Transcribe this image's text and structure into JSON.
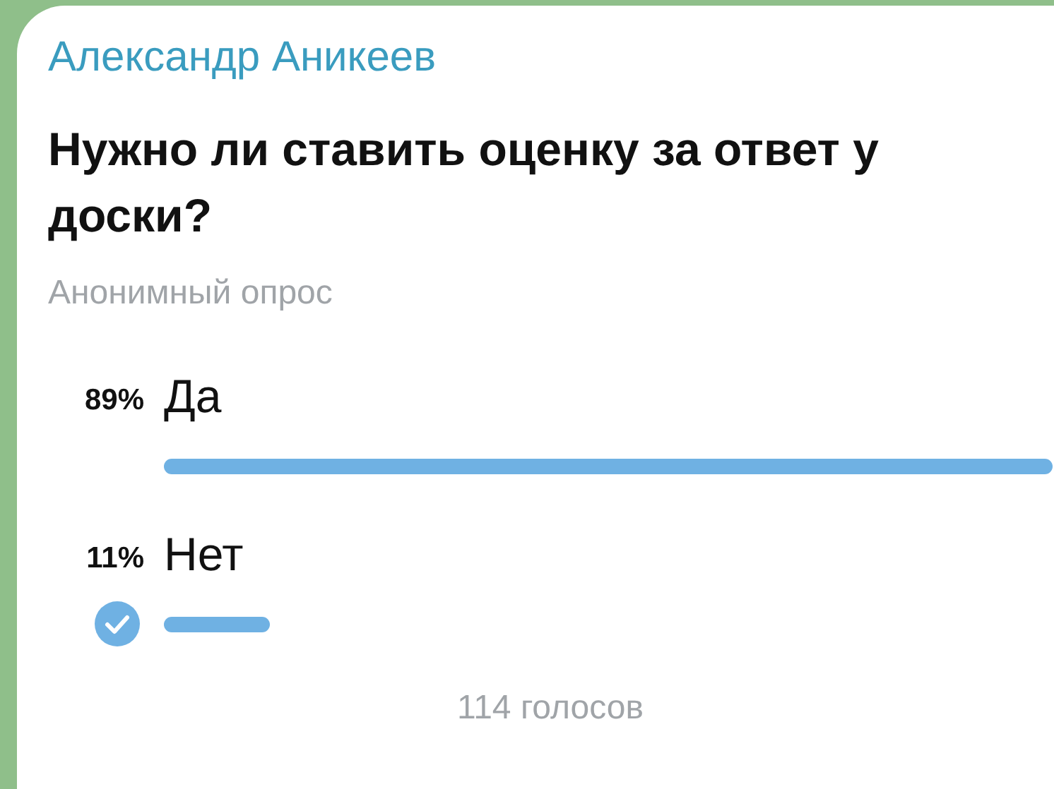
{
  "author": "Александр Аникеев",
  "question": "Нужно ли ставить оценку за ответ у доски?",
  "poll_type": "Анонимный опрос",
  "options": [
    {
      "percent": "89%",
      "label": "Да",
      "selected": false
    },
    {
      "percent": "11%",
      "label": "Нет",
      "selected": true
    }
  ],
  "votes": "114 голосов"
}
